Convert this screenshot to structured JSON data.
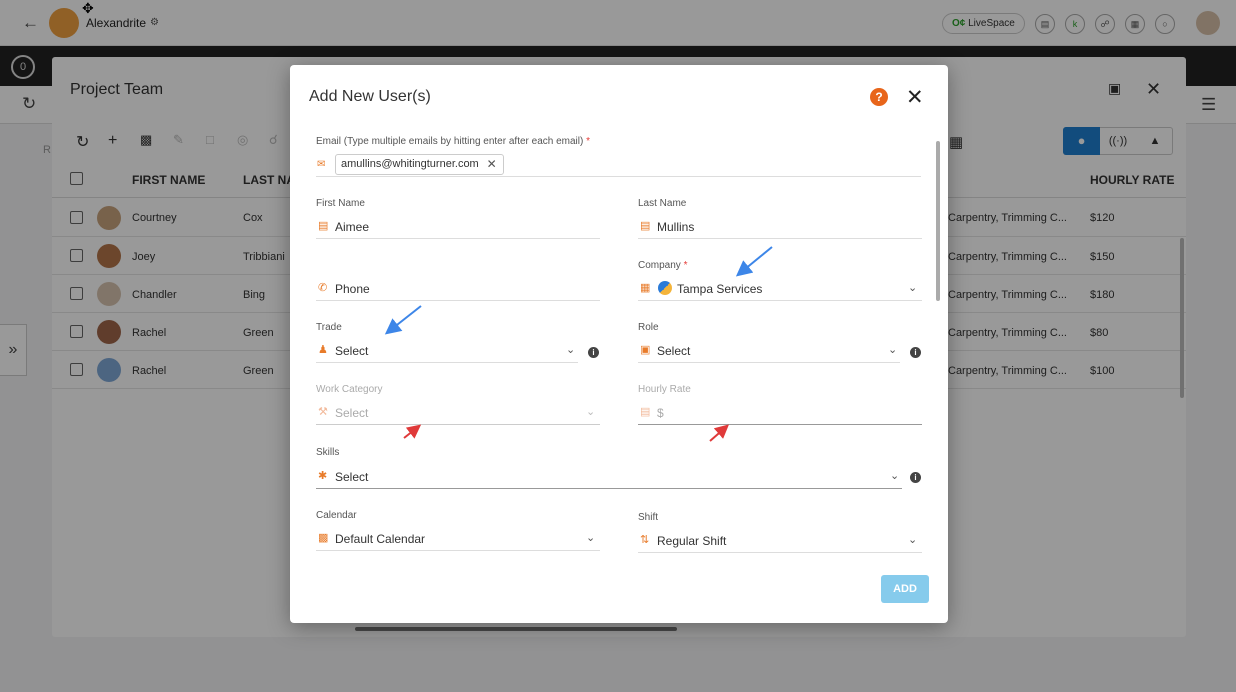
{
  "topbar": {
    "project_name": "Alexandrite",
    "livespace_prefix": "O¢",
    "livespace_label": "LiveSpace",
    "icons": [
      "notes-icon",
      "k-icon",
      "headset-icon",
      "qr-icon",
      "chat-icon"
    ]
  },
  "panel": {
    "title": "Project Team",
    "sub_label": "R",
    "columns": {
      "first": "FIRST NAME",
      "last": "LAST NA",
      "hourly": "HOURLY RATE"
    },
    "rows": [
      {
        "first": "Courtney",
        "last": "Cox",
        "trade": "Carpentry, Trimming C...",
        "rate": "$120"
      },
      {
        "first": "Joey",
        "last": "Tribbiani",
        "trade": "Carpentry, Trimming C...",
        "rate": "$150"
      },
      {
        "first": "Chandler",
        "last": "Bing",
        "trade": "Carpentry, Trimming C...",
        "rate": "$180"
      },
      {
        "first": "Rachel",
        "last": "Green",
        "trade": "Carpentry, Trimming C...",
        "rate": "$80"
      },
      {
        "first": "Rachel",
        "last": "Green",
        "trade": "Carpentry, Trimming C...",
        "rate": "$100"
      }
    ]
  },
  "modal": {
    "title": "Add New User(s)",
    "help_glyph": "?",
    "email_label": "Email (Type multiple emails by hitting enter after each email)",
    "required_mark": "*",
    "email_chip": "amullins@whitingturner.com",
    "first_name_label": "First Name",
    "first_name_value": "Aimee",
    "last_name_label": "Last Name",
    "last_name_value": "Mullins",
    "phone_placeholder": "Phone",
    "company_label": "Company",
    "company_value": "Tampa Services",
    "trade_label": "Trade",
    "trade_value": "Select",
    "role_label": "Role",
    "role_value": "Select",
    "work_category_label": "Work Category",
    "work_category_value": "Select",
    "hourly_rate_label": "Hourly Rate",
    "hourly_rate_value": "$",
    "skills_label": "Skills",
    "skills_value": "Select",
    "calendar_label": "Calendar",
    "calendar_value": "Default Calendar",
    "shift_label": "Shift",
    "shift_value": "Regular Shift",
    "add_label": "ADD",
    "add_disabled": true
  },
  "colors": {
    "accent": "#1e7fd0",
    "orange": "#e87b2a",
    "add_button": "#86cbec",
    "annotation_blue": "#3d86e8",
    "annotation_red": "#e03a3a"
  }
}
